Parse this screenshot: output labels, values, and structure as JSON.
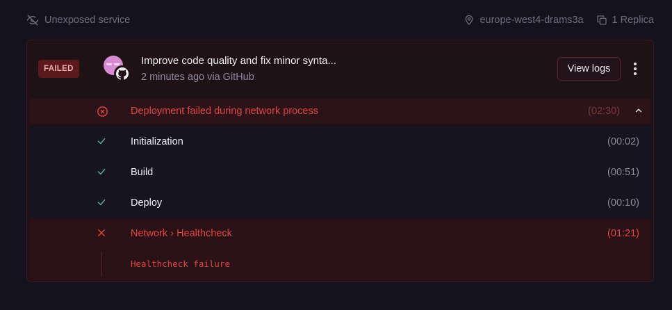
{
  "topbar": {
    "exposure": "Unexposed service",
    "region": "europe-west4-drams3a",
    "replicas": "1 Replica"
  },
  "deployment": {
    "status": "FAILED",
    "commit_title": "Improve code quality and fix minor synta...",
    "meta": "2 minutes ago via GitHub",
    "view_logs_label": "View logs"
  },
  "failure": {
    "message": "Deployment failed during network process",
    "duration": "(02:30)"
  },
  "steps": [
    {
      "name": "Initialization",
      "duration": "(00:02)",
      "status": "success"
    },
    {
      "name": "Build",
      "duration": "(00:51)",
      "status": "success"
    },
    {
      "name": "Deploy",
      "duration": "(00:10)",
      "status": "success"
    },
    {
      "name": "Network › Healthcheck",
      "duration": "(01:21)",
      "status": "failed"
    }
  ],
  "log": {
    "message": "Healthcheck failure"
  },
  "colors": {
    "error": "#e0453f",
    "success": "#4fb39a",
    "background": "#14131d"
  },
  "icons": {
    "exposure": "eye-off-icon",
    "region": "map-pin-icon",
    "replicas": "copy-icon",
    "failure": "circle-x-icon",
    "collapse": "chevron-up-icon",
    "step_success": "check-icon",
    "step_failed": "x-icon"
  }
}
